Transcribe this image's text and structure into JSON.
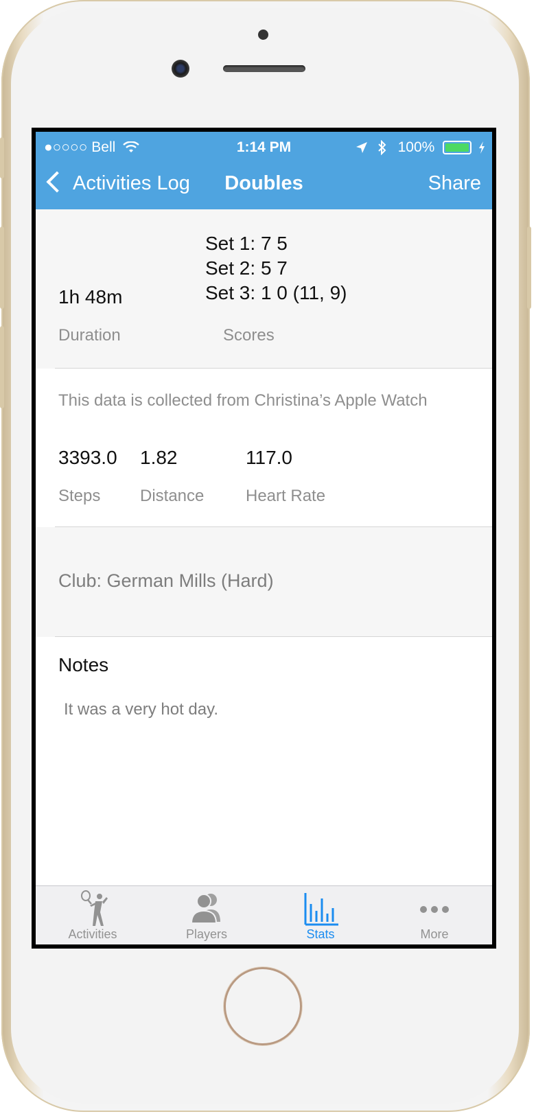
{
  "status_bar": {
    "carrier": "●○○○○ Bell",
    "time": "1:14 PM",
    "battery": "100%"
  },
  "nav": {
    "back_label": "Activities Log",
    "title": "Doubles",
    "share_label": "Share"
  },
  "summary": {
    "duration_value": "1h 48m",
    "duration_label": "Duration",
    "scores": [
      "Set 1: 7 5",
      "Set 2: 5 7",
      "Set 3: 1 0 (11, 9)"
    ],
    "scores_label": "Scores"
  },
  "watch": {
    "source_text": "This data is collected from Christina’s Apple Watch",
    "steps_value": "3393.0",
    "steps_label": "Steps",
    "distance_value": "1.82",
    "distance_label": "Distance",
    "heart_value": "117.0",
    "heart_label": "Heart Rate"
  },
  "club": {
    "text": "Club: German Mills (Hard)"
  },
  "notes": {
    "title": "Notes",
    "text": "It was a very hot day."
  },
  "tabbar": {
    "items": [
      {
        "label": "Activities",
        "icon": "tennis-player-icon"
      },
      {
        "label": "Players",
        "icon": "people-icon"
      },
      {
        "label": "Stats",
        "icon": "bar-chart-icon"
      },
      {
        "label": "More",
        "icon": "more-dots-icon"
      }
    ],
    "active_color": "#1a8cf0",
    "inactive_color": "#929292"
  },
  "colors": {
    "nav_bar": "#4fa4e0",
    "grey_section": "#f6f6f6"
  }
}
